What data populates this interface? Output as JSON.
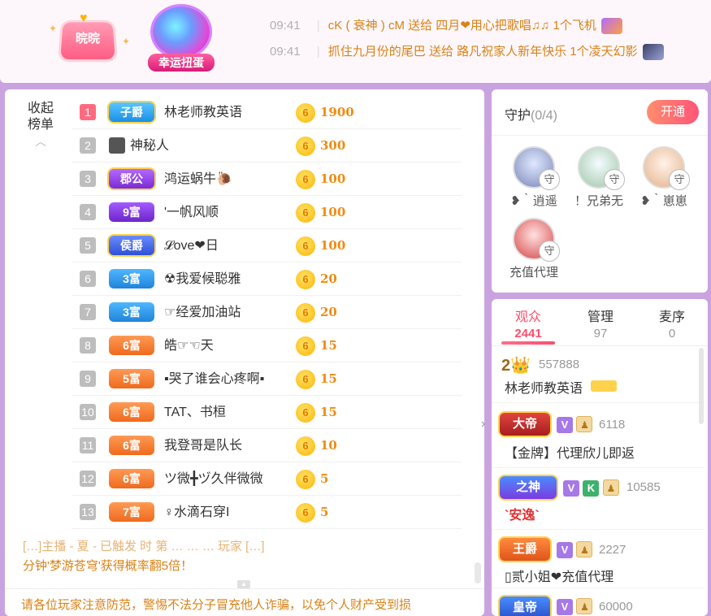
{
  "banner": {
    "heart_badge": "晥晥",
    "lucky_label": "幸运扭蛋",
    "messages": [
      {
        "time": "09:41",
        "text": "cK ( 衰神 ) cM 送给 四月❤用心把歌唱♫♫ 1个飞机"
      },
      {
        "time": "09:41",
        "text": "抓住九月份的尾巴 送给 路凡祝家人新年快乐 1个凌天幻影"
      }
    ]
  },
  "rank": {
    "collapse_label_1": "收起",
    "collapse_label_2": "榜单",
    "rows": [
      {
        "num": "1",
        "badge": "子爵",
        "name": "林老师教英语",
        "coin": "6",
        "value": "1900"
      },
      {
        "num": "2",
        "badge": "",
        "name": "神秘人",
        "coin": "6",
        "value": "300"
      },
      {
        "num": "3",
        "badge": "郡公",
        "name": "鸿运蜗牛🐌",
        "coin": "6",
        "value": "100"
      },
      {
        "num": "4",
        "badge": "9富",
        "name": "'一帆风顺",
        "coin": "6",
        "value": "100"
      },
      {
        "num": "5",
        "badge": "侯爵",
        "name": "𝓛ove❤日",
        "coin": "6",
        "value": "100"
      },
      {
        "num": "6",
        "badge": "3富",
        "name": "☢我爱候聪雅",
        "coin": "6",
        "value": "20"
      },
      {
        "num": "7",
        "badge": "3富",
        "name": "☞经爱加油站",
        "coin": "6",
        "value": "20"
      },
      {
        "num": "8",
        "badge": "6富",
        "name": "皓☞☜天",
        "coin": "6",
        "value": "15"
      },
      {
        "num": "9",
        "badge": "5富",
        "name": "▪哭了谁会心疼啊▪",
        "coin": "6",
        "value": "15"
      },
      {
        "num": "10",
        "badge": "6富",
        "name": "TAT、书桓",
        "coin": "6",
        "value": "15"
      },
      {
        "num": "11",
        "badge": "6富",
        "name": "我登哥是队长",
        "coin": "6",
        "value": "10"
      },
      {
        "num": "12",
        "badge": "6富",
        "name": "ツ微╋ヅ久伴微微",
        "coin": "6",
        "value": "5"
      },
      {
        "num": "13",
        "badge": "7富",
        "name": "♀水滴石穿I",
        "coin": "6",
        "value": "5"
      }
    ]
  },
  "notices": {
    "partial": "[…]主播 - 夏 - 已触发 时 第 …  …  … 玩家 […]",
    "line1": "分钟'梦游苍穹'获得概率翻5倍！",
    "line2": "请各位玩家注意防范，警惕不法分子冒充他人诈骗，以免个人财产受到损"
  },
  "guard": {
    "title": "守护",
    "count": "(0/4)",
    "open_button": "开通",
    "shou": "守",
    "members": [
      {
        "name": "❥｀逍遥"
      },
      {
        "name": "！兄弟无"
      },
      {
        "name": "❥｀崽崽"
      },
      {
        "name": "充值代理"
      }
    ]
  },
  "audience": {
    "tabs": [
      {
        "label": "观众",
        "count": "2441"
      },
      {
        "label": "管理",
        "count": "97"
      },
      {
        "label": "麦序",
        "count": "0"
      }
    ],
    "items": [
      {
        "level": "2👑",
        "id": "557888",
        "name": "林老师教英语",
        "badges": []
      },
      {
        "level": "大帝",
        "id": "6118",
        "name": "【金牌】代理欣儿即返",
        "badges": [
          "V",
          "M"
        ]
      },
      {
        "level": "之神",
        "id": "10585",
        "name": "`安逸`",
        "badges": [
          "V",
          "K",
          "M"
        ]
      },
      {
        "level": "王爵",
        "id": "2227",
        "name": "▯贰小姐❤充值代理",
        "badges": [
          "V",
          "M"
        ]
      },
      {
        "level": "皇帝",
        "id": "60000",
        "name": "",
        "badges": [
          "V",
          "M"
        ]
      }
    ]
  },
  "colors": {
    "accent": "#ff4d6d",
    "gold": "#f08b12",
    "bg": "#c9a3e0"
  }
}
